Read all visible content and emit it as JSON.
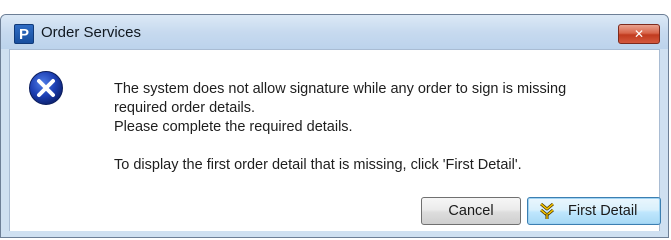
{
  "dialog": {
    "title": "Order Services",
    "app_icon_letter": "P",
    "close_symbol": "✕",
    "message": {
      "line1": "The system does not allow signature while any order to sign is missing",
      "line2": "required order details.",
      "line3": "Please complete the required details.",
      "line4": "To display the first order detail that is missing, click 'First Detail'."
    },
    "icon": "error-circle-x-icon",
    "buttons": {
      "cancel_label": "Cancel",
      "first_detail_label": "First Detail",
      "first_detail_icon": "double-chevron-down-arrow-icon"
    }
  },
  "colors": {
    "titlebar": "#c7daef",
    "close_button": "#c13b1f",
    "error_icon": "#1a3fb0",
    "focused_button": "#bee6fd",
    "first_detail_icon": "#e1b400"
  }
}
